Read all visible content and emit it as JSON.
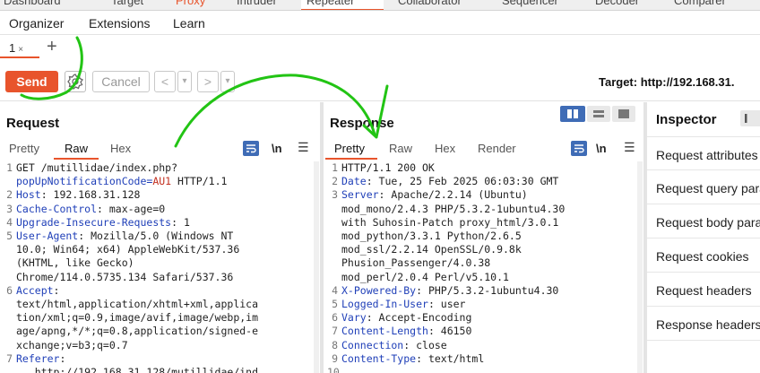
{
  "top_tabs": [
    "Dashboard",
    "Target",
    "Proxy",
    "Intruder",
    "Repeater",
    "Collaborator",
    "Sequencer",
    "Decoder",
    "Comparer"
  ],
  "sub_tabs": [
    "Organizer",
    "Extensions",
    "Learn"
  ],
  "request_tab": {
    "label": "1",
    "close": "×",
    "add": "+"
  },
  "toolbar": {
    "send_label": "Send",
    "cancel_label": "Cancel",
    "back_glyph": "<",
    "back_menu_glyph": "▾",
    "forward_glyph": ">",
    "forward_menu_glyph": "▾",
    "target_label": "Target: http://192.168.31."
  },
  "request_panel": {
    "title": "Request",
    "tabs": [
      "Pretty",
      "Raw",
      "Hex"
    ],
    "active_tab": "Raw",
    "newline_label": "\\n",
    "menu_glyph": "☰"
  },
  "response_panel": {
    "title": "Response",
    "tabs": [
      "Pretty",
      "Raw",
      "Hex",
      "Render"
    ],
    "active_tab": "Pretty",
    "newline_label": "\\n",
    "menu_glyph": "☰"
  },
  "request_lines": [
    {
      "n": "1",
      "segments": [
        {
          "t": "GET /mutillidae/index.php?",
          "c": "v"
        }
      ]
    },
    {
      "n": "",
      "segments": [
        {
          "t": "popUpNotificationCode=",
          "c": "k"
        },
        {
          "t": "AU1",
          "c": "pv"
        },
        {
          "t": " HTTP/1.1",
          "c": "v"
        }
      ]
    },
    {
      "n": "2",
      "segments": [
        {
          "t": "Host",
          "c": "k"
        },
        {
          "t": ": 192.168.31.128",
          "c": "v"
        }
      ]
    },
    {
      "n": "3",
      "segments": [
        {
          "t": "Cache-Control",
          "c": "k"
        },
        {
          "t": ": max-age=0",
          "c": "v"
        }
      ]
    },
    {
      "n": "4",
      "segments": [
        {
          "t": "Upgrade-Insecure-Requests",
          "c": "k"
        },
        {
          "t": ": 1",
          "c": "v"
        }
      ]
    },
    {
      "n": "5",
      "segments": [
        {
          "t": "User-Agent",
          "c": "k"
        },
        {
          "t": ": Mozilla/5.0 (Windows NT",
          "c": "v"
        }
      ]
    },
    {
      "n": "",
      "segments": [
        {
          "t": "10.0; Win64; x64) AppleWebKit/537.36",
          "c": "v"
        }
      ]
    },
    {
      "n": "",
      "segments": [
        {
          "t": "(KHTML, like Gecko)",
          "c": "v"
        }
      ]
    },
    {
      "n": "",
      "segments": [
        {
          "t": "Chrome/114.0.5735.134 Safari/537.36",
          "c": "v"
        }
      ]
    },
    {
      "n": "6",
      "segments": [
        {
          "t": "Accept",
          "c": "k"
        },
        {
          "t": ":",
          "c": "v"
        }
      ]
    },
    {
      "n": "",
      "segments": [
        {
          "t": "text/html,application/xhtml+xml,applica",
          "c": "v"
        }
      ]
    },
    {
      "n": "",
      "segments": [
        {
          "t": "tion/xml;q=0.9,image/avif,image/webp,im",
          "c": "v"
        }
      ]
    },
    {
      "n": "",
      "segments": [
        {
          "t": "age/apng,*/*;q=0.8,application/signed-e",
          "c": "v"
        }
      ]
    },
    {
      "n": "",
      "segments": [
        {
          "t": "xchange;v=b3;q=0.7",
          "c": "v"
        }
      ]
    },
    {
      "n": "7",
      "segments": [
        {
          "t": "Referer",
          "c": "k"
        },
        {
          "t": ":",
          "c": "v"
        }
      ]
    },
    {
      "n": "",
      "segments": [
        {
          "t": "   http://192.168.31.128/mutillidae/ind",
          "c": "v"
        }
      ]
    }
  ],
  "response_lines": [
    {
      "n": "1",
      "segments": [
        {
          "t": "HTTP/1.1 200 OK",
          "c": "v"
        }
      ]
    },
    {
      "n": "2",
      "segments": [
        {
          "t": "Date",
          "c": "k"
        },
        {
          "t": ": Tue, 25 Feb 2025 06:03:30 GMT",
          "c": "v"
        }
      ]
    },
    {
      "n": "3",
      "segments": [
        {
          "t": "Server",
          "c": "k"
        },
        {
          "t": ": Apache/2.2.14 (Ubuntu)",
          "c": "v"
        }
      ]
    },
    {
      "n": "",
      "segments": [
        {
          "t": "mod_mono/2.4.3 PHP/5.3.2-1ubuntu4.30",
          "c": "v"
        }
      ]
    },
    {
      "n": "",
      "segments": [
        {
          "t": "with Suhosin-Patch proxy_html/3.0.1",
          "c": "v"
        }
      ]
    },
    {
      "n": "",
      "segments": [
        {
          "t": "mod_python/3.3.1 Python/2.6.5",
          "c": "v"
        }
      ]
    },
    {
      "n": "",
      "segments": [
        {
          "t": "mod_ssl/2.2.14 OpenSSL/0.9.8k",
          "c": "v"
        }
      ]
    },
    {
      "n": "",
      "segments": [
        {
          "t": "Phusion_Passenger/4.0.38",
          "c": "v"
        }
      ]
    },
    {
      "n": "",
      "segments": [
        {
          "t": "mod_perl/2.0.4 Perl/v5.10.1",
          "c": "v"
        }
      ]
    },
    {
      "n": "4",
      "segments": [
        {
          "t": "X-Powered-By",
          "c": "k"
        },
        {
          "t": ": PHP/5.3.2-1ubuntu4.30",
          "c": "v"
        }
      ]
    },
    {
      "n": "5",
      "segments": [
        {
          "t": "Logged-In-User",
          "c": "k"
        },
        {
          "t": ": user",
          "c": "v"
        }
      ]
    },
    {
      "n": "6",
      "segments": [
        {
          "t": "Vary",
          "c": "k"
        },
        {
          "t": ": Accept-Encoding",
          "c": "v"
        }
      ]
    },
    {
      "n": "7",
      "segments": [
        {
          "t": "Content-Length",
          "c": "k"
        },
        {
          "t": ": 46150",
          "c": "v"
        }
      ]
    },
    {
      "n": "8",
      "segments": [
        {
          "t": "Connection",
          "c": "k"
        },
        {
          "t": ": close",
          "c": "v"
        }
      ]
    },
    {
      "n": "9",
      "segments": [
        {
          "t": "Content-Type",
          "c": "k"
        },
        {
          "t": ": text/html",
          "c": "v"
        }
      ]
    },
    {
      "n": "10",
      "segments": [
        {
          "t": "",
          "c": "v"
        }
      ]
    }
  ],
  "inspector": {
    "title": "Inspector",
    "items": [
      "Request attributes",
      "Request query parameters",
      "Request body parameters",
      "Request cookies",
      "Request headers",
      "Response headers"
    ]
  },
  "colors": {
    "accent": "#e8542c",
    "header_key": "#1f3fb8",
    "param_value": "#c23020",
    "toggle_blue": "#3f6cb6",
    "annotation": "#22c414"
  }
}
